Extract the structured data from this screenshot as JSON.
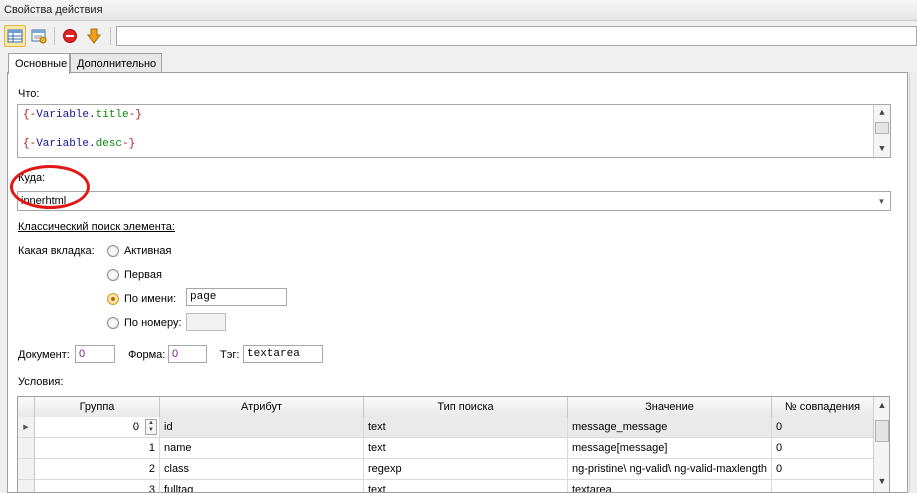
{
  "window": {
    "title": "Свойства действия"
  },
  "toolbar": {
    "buttons": [
      {
        "icon": "table-view-icon"
      },
      {
        "icon": "window-settings-icon"
      },
      {
        "icon": "stop-icon",
        "color": "#e02424"
      },
      {
        "icon": "arrow-down-icon",
        "color": "#f0a020"
      }
    ],
    "input_value": ""
  },
  "tabs": [
    {
      "label": "Основные",
      "active": true
    },
    {
      "label": "Дополнительно",
      "active": false
    }
  ],
  "what": {
    "label": "Что:",
    "lines": [
      {
        "open": "{-",
        "var": "Variable",
        "dot": ".",
        "prop": "title",
        "close": "-}"
      },
      {
        "open": "{-",
        "var": "Variable",
        "dot": ".",
        "prop": "desc",
        "close": "-}"
      }
    ]
  },
  "where": {
    "label": "Куда:",
    "value": "innerhtml"
  },
  "search": {
    "header": "Классический поиск элемента:",
    "tab_label": "Какая вкладка:",
    "options": {
      "active": "Активная",
      "first": "Первая",
      "by_name": "По имени:",
      "by_number": "По номеру:"
    },
    "selected": "by_name",
    "by_name_value": "page",
    "by_number_value": ""
  },
  "fields": {
    "document_label": "Документ:",
    "document_value": "0",
    "form_label": "Форма:",
    "form_value": "0",
    "tag_label": "Тэг:",
    "tag_value": "textarea"
  },
  "conditions": {
    "label": "Условия:",
    "columns": [
      "Группа",
      "Атрибут",
      "Тип поиска",
      "Значение",
      "№ совпадения"
    ],
    "rows": [
      {
        "group": "0",
        "attribute": "id",
        "type": "text",
        "value": "message_message",
        "match": "0"
      },
      {
        "group": "1",
        "attribute": "name",
        "type": "text",
        "value": "message[message]",
        "match": "0"
      },
      {
        "group": "2",
        "attribute": "class",
        "type": "regexp",
        "value": "ng-pristine\\ ng-valid\\ ng-valid-maxlength",
        "match": "0"
      },
      {
        "group": "3",
        "attribute": "fulltag",
        "type": "text",
        "value": "textarea",
        "match": ""
      }
    ]
  },
  "colors": {
    "annotation_circle": "#e01818",
    "accent": "#f6d27a"
  }
}
